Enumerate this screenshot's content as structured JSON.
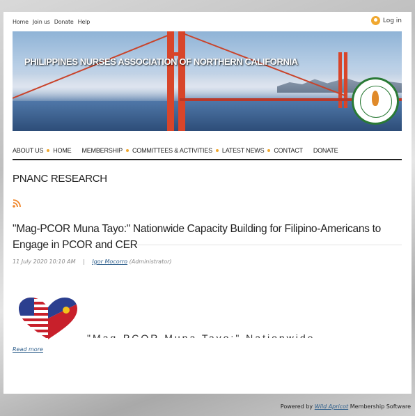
{
  "topnav": {
    "home": "Home",
    "join": "Join us",
    "donate": "Donate",
    "help": "Help"
  },
  "login": {
    "label": "Log in"
  },
  "banner": {
    "title": "PHILIPPINES NURSES ASSOCIATION OF NORTHERN CALIFORNIA"
  },
  "mainnav": {
    "items": [
      "ABOUT US",
      "HOME",
      "MEMBERSHIP",
      "COMMITTEES & ACTIVITIES",
      "LATEST NEWS",
      "CONTACT",
      "DONATE"
    ]
  },
  "page": {
    "title": "PNANC RESEARCH"
  },
  "post": {
    "title": "\"Mag-PCOR Muna Tayo:\" Nationwide Capacity Building for Filipino-Americans to Engage in PCOR and CER",
    "date": "11 July 2020 10:10 AM",
    "separator": "|",
    "author": "Igor Mocorro",
    "role": "(Administrator)",
    "excerpt": "\"Mag-PCOR Muna Tayo:\" Nationwide",
    "read_more": "Read more"
  },
  "footer": {
    "prefix": "Powered by",
    "brand": "Wild Apricot",
    "suffix": "Membership Software"
  },
  "colors": {
    "accent_dot": "#f0a830",
    "link": "#2b5c8a",
    "bridge": "#d8452a"
  }
}
